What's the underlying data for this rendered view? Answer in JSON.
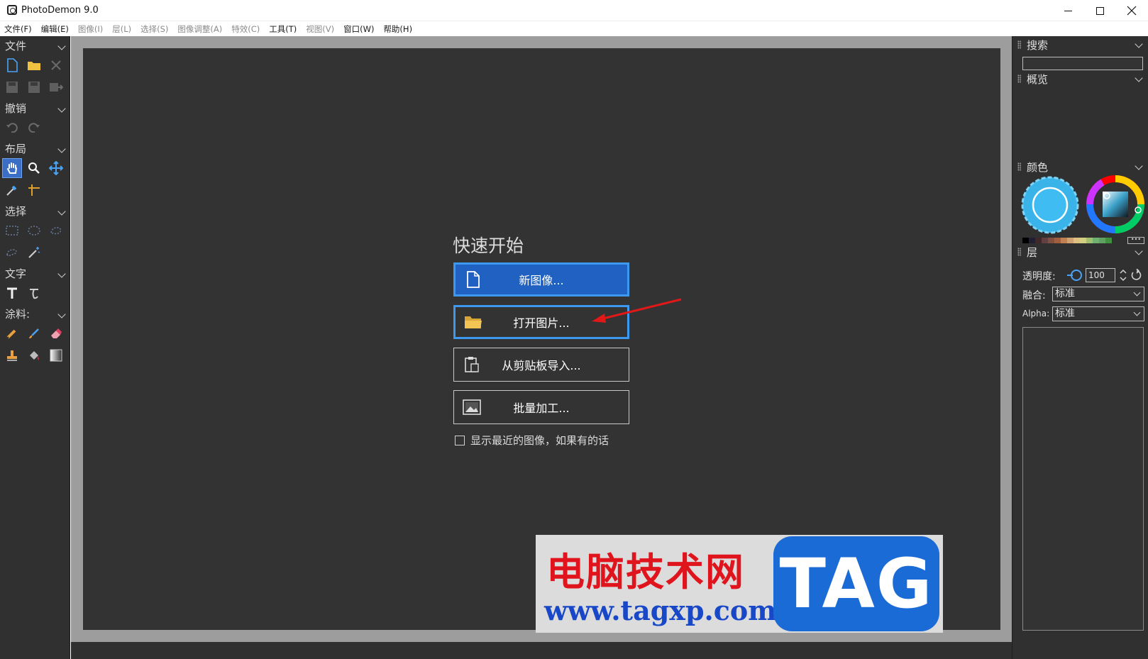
{
  "app": {
    "title": "PhotoDemon 9.0"
  },
  "menu": [
    {
      "label": "文件(F)",
      "dim": false
    },
    {
      "label": "编辑(E)",
      "dim": false
    },
    {
      "label": "图像(I)",
      "dim": true
    },
    {
      "label": "层(L)",
      "dim": true
    },
    {
      "label": "选择(S)",
      "dim": true
    },
    {
      "label": "图像调整(A)",
      "dim": true
    },
    {
      "label": "特效(C)",
      "dim": true
    },
    {
      "label": "工具(T)",
      "dim": false
    },
    {
      "label": "视图(V)",
      "dim": true
    },
    {
      "label": "窗口(W)",
      "dim": false
    },
    {
      "label": "帮助(H)",
      "dim": false
    }
  ],
  "toolbox": {
    "file": "文件",
    "undo": "撤销",
    "layout": "布局",
    "select": "选择",
    "text": "文字",
    "paint": "涂料:"
  },
  "quickstart": {
    "title": "快速开始",
    "new_image": "新图像...",
    "open_image": "打开图片...",
    "import_clipboard": "从剪贴板导入...",
    "batch": "批量加工...",
    "show_recent": "显示最近的图像，如果有的话"
  },
  "panel": {
    "search": "搜索",
    "overview": "概览",
    "color": "颜色",
    "layers": "层",
    "opacity_label": "透明度:",
    "opacity_value": "100",
    "blend_label": "融合:",
    "blend_value": "标准",
    "alpha_label": "Alpha:",
    "alpha_value": "标准",
    "more": "•••"
  },
  "watermark": {
    "site_cn": "电脑技术网",
    "url": "www.tagxp.com",
    "tag": "TAG"
  },
  "colors": {
    "accent": "#3d98f0",
    "primary_button": "#2161c2",
    "arrow": "#e01818",
    "palette": [
      "#000000",
      "#202030",
      "#402828",
      "#604040",
      "#805040",
      "#a06040",
      "#c08050",
      "#d0a070",
      "#e0c080",
      "#d0d080",
      "#a0c070",
      "#70b070",
      "#60a060",
      "#409040"
    ]
  }
}
